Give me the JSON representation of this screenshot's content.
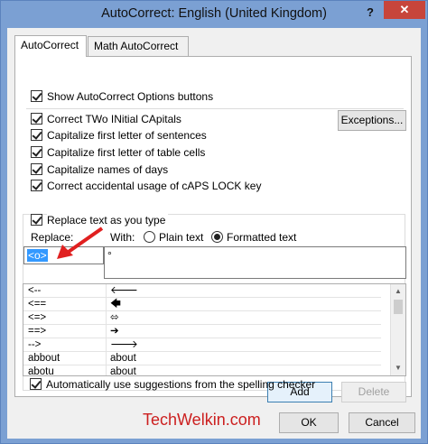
{
  "window": {
    "title": "AutoCorrect: English (United Kingdom)",
    "help_label": "?",
    "close_label": "✕"
  },
  "tabs": [
    {
      "label": "AutoCorrect"
    },
    {
      "label": "Math AutoCorrect"
    }
  ],
  "options": {
    "show_buttons": "Show AutoCorrect Options buttons",
    "two_initial": "Correct TWo INitial CApitals",
    "first_letter_sentences": "Capitalize first letter of sentences",
    "first_letter_table": "Capitalize first letter of table cells",
    "names_of_days": "Capitalize names of days",
    "caps_lock": "Correct accidental usage of cAPS LOCK key",
    "exceptions_button": "Exceptions..."
  },
  "replace_section": {
    "replace_as_you_type": "Replace text as you type",
    "replace_label": "Replace:",
    "with_label": "With:",
    "plain_text": "Plain text",
    "formatted_text": "Formatted text",
    "replace_value": "<o>",
    "with_value": "°"
  },
  "entries": [
    {
      "replace": "<--",
      "with": "🡐"
    },
    {
      "replace": "<==",
      "with": "🡄"
    },
    {
      "replace": "<=>",
      "with": "⬄"
    },
    {
      "replace": "==>",
      "with": "➔"
    },
    {
      "replace": "-->",
      "with": "🡒"
    },
    {
      "replace": "abbout",
      "with": "about"
    },
    {
      "replace": "abotu",
      "with": "about"
    }
  ],
  "buttons": {
    "add": "Add",
    "delete": "Delete",
    "ok": "OK",
    "cancel": "Cancel"
  },
  "spelling_suggestions": "Automatically use suggestions from the spelling checker",
  "watermark": "TechWelkin.com",
  "colors": {
    "accent": "#3399ff",
    "arrow": "#e02020",
    "watermark": "#cc1f1f"
  }
}
